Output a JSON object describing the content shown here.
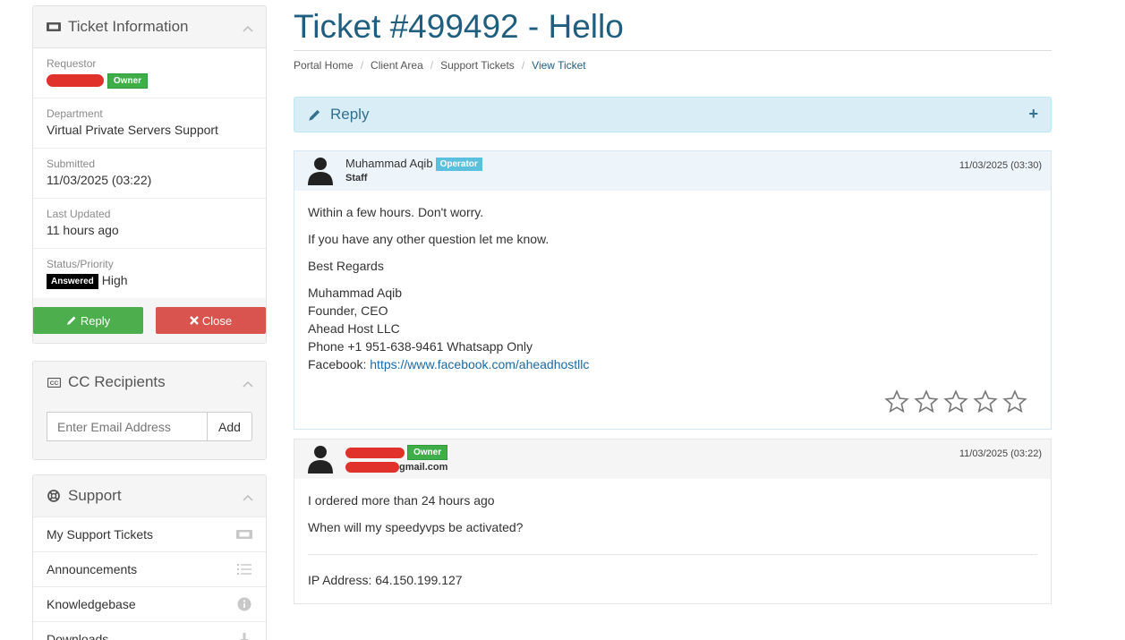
{
  "ticket_info": {
    "title": "Ticket Information",
    "requestor_label": "Requestor",
    "requestor_badge": "Owner",
    "department_label": "Department",
    "department_value": "Virtual Private Servers Support",
    "submitted_label": "Submitted",
    "submitted_value": "11/03/2025 (03:22)",
    "updated_label": "Last Updated",
    "updated_value": "11 hours ago",
    "status_label": "Status/Priority",
    "status_badge": "Answered",
    "priority_value": "High",
    "reply_button": "Reply",
    "close_button": "Close"
  },
  "cc": {
    "title": "CC Recipients",
    "placeholder": "Enter Email Address",
    "add_button": "Add"
  },
  "support": {
    "title": "Support",
    "items": [
      {
        "label": "My Support Tickets",
        "icon": "ticket-icon"
      },
      {
        "label": "Announcements",
        "icon": "list-icon"
      },
      {
        "label": "Knowledgebase",
        "icon": "info-icon"
      },
      {
        "label": "Downloads",
        "icon": "download-icon"
      }
    ]
  },
  "page": {
    "title": "Ticket #499492 - Hello",
    "breadcrumb": [
      "Portal Home",
      "Client Area",
      "Support Tickets",
      "View Ticket"
    ],
    "reply_bar_label": "Reply"
  },
  "messages": [
    {
      "author": "Muhammad Aqib",
      "badge": "Operator",
      "role": "Staff",
      "date": "11/03/2025 (03:30)",
      "lines": [
        "Within a few hours. Don't worry.",
        "If you have any other question let me know.",
        "Best Regards"
      ],
      "signature": [
        "Muhammad Aqib",
        "Founder, CEO",
        "Ahead Host LLC",
        "Phone +1 951-638-9461 Whatsapp Only"
      ],
      "facebook_label": "Facebook:",
      "facebook_link": "https://www.facebook.com/aheadhostllc"
    },
    {
      "badge": "Owner",
      "email_suffix": "gmail.com",
      "date": "11/03/2025 (03:22)",
      "lines": [
        "I ordered more than 24 hours ago",
        "When will my speedyvps be activated?"
      ],
      "ip_line": "IP Address: 64.150.199.127"
    }
  ],
  "colors": {
    "title": "#1f5e7f",
    "reply_green": "#4cae4c",
    "close_red": "#d9534f",
    "operator_badge": "#5bc0de",
    "owner_badge": "#3fae49",
    "reply_bar_bg": "#d9edf7"
  }
}
